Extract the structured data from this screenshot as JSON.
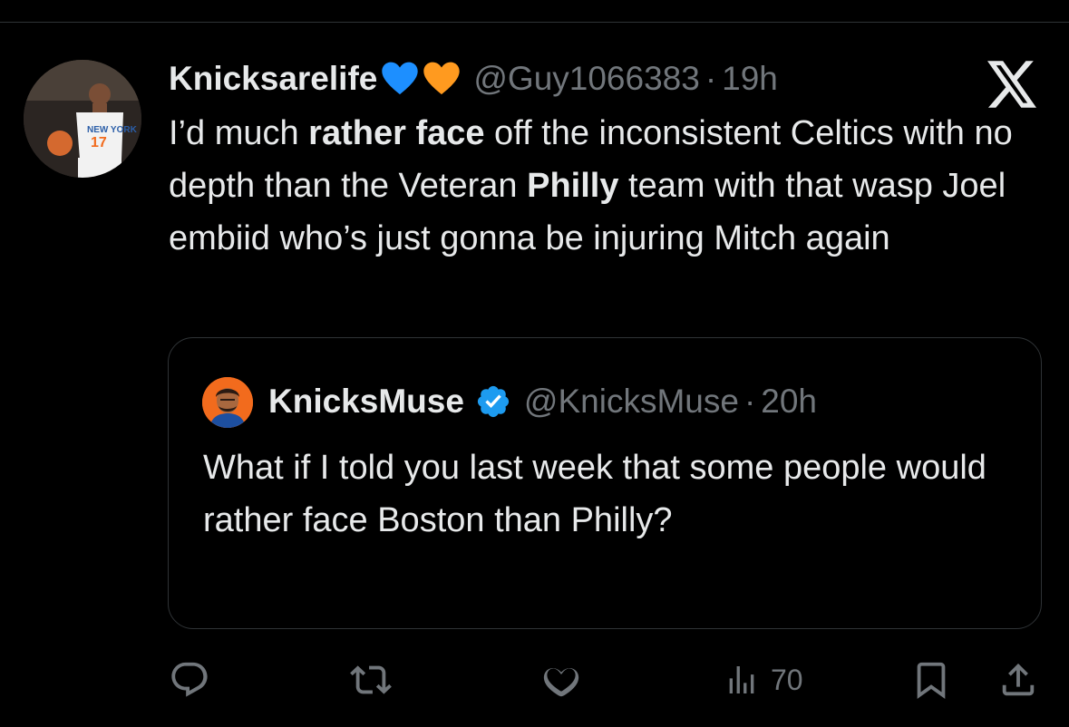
{
  "tweet": {
    "display_name": "Knicksarelife",
    "emoji": [
      "blue-heart",
      "orange-heart"
    ],
    "handle": "@Guy1066383",
    "separator": "·",
    "time": "19h",
    "text_parts": [
      {
        "t": "I’d much ",
        "b": false
      },
      {
        "t": "rather face",
        "b": true
      },
      {
        "t": " off the inconsistent Celtics with no depth than the Veteran ",
        "b": false
      },
      {
        "t": "Philly",
        "b": true
      },
      {
        "t": " team with that wasp Joel embiid who’s just gonna be injuring Mitch again",
        "b": false
      }
    ]
  },
  "quote": {
    "display_name": "KnicksMuse",
    "verified": true,
    "handle": "@KnicksMuse",
    "separator": "·",
    "time": "20h",
    "text": "What if I told you last week that some people would rather face Boston than Philly?"
  },
  "actions": {
    "views": "70",
    "icons": [
      "reply-icon",
      "retweet-icon",
      "like-icon",
      "views-icon",
      "bookmark-icon",
      "share-icon"
    ]
  },
  "colors": {
    "background": "#000000",
    "text": "#e7e9ea",
    "muted": "#71767b",
    "border": "#2f3336",
    "verified": "#1d9bf0",
    "blue_heart": "#1d8fff",
    "orange_heart": "#ff9a1f"
  }
}
